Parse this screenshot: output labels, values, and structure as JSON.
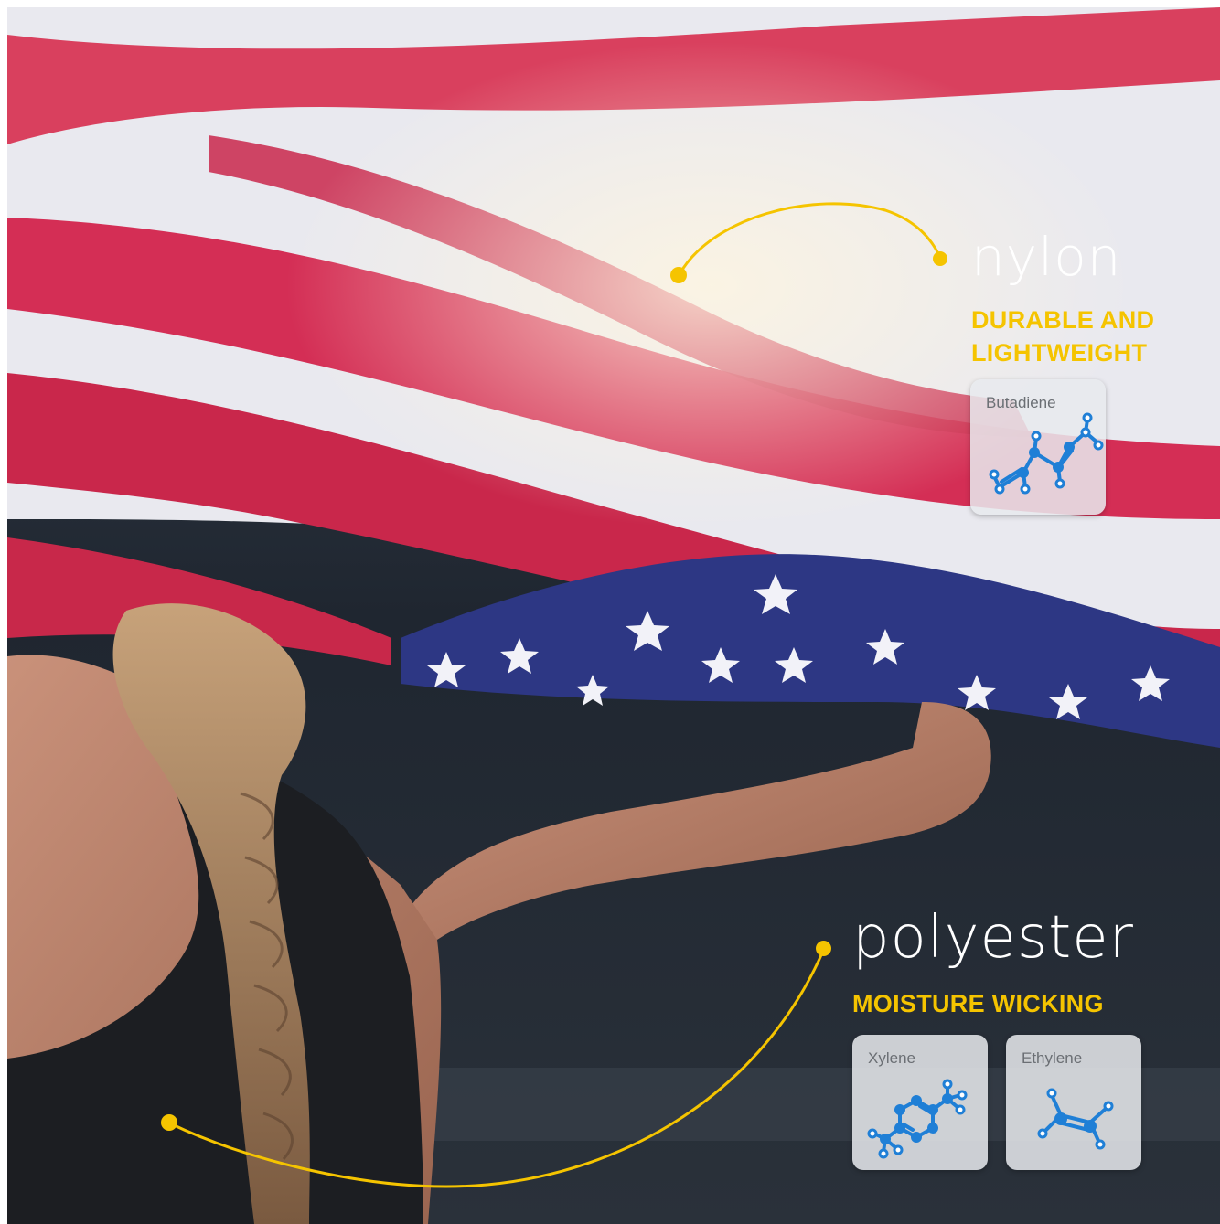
{
  "nylon": {
    "title": "nylon",
    "subtitle_line1": "DURABLE AND",
    "subtitle_line2": "LIGHTWEIGHT",
    "molecules": [
      {
        "name": "Butadiene",
        "icon": "butadiene-molecule-icon"
      }
    ]
  },
  "polyester": {
    "title": "polyester",
    "subtitle": "MOISTURE WICKING",
    "molecules": [
      {
        "name": "Xylene",
        "icon": "xylene-molecule-icon"
      },
      {
        "name": "Ethylene",
        "icon": "ethylene-molecule-icon"
      }
    ]
  },
  "colors": {
    "accent_yellow": "#f5c400",
    "molecule_blue": "#1f7fd6",
    "card_bg": "#e8eaee"
  }
}
